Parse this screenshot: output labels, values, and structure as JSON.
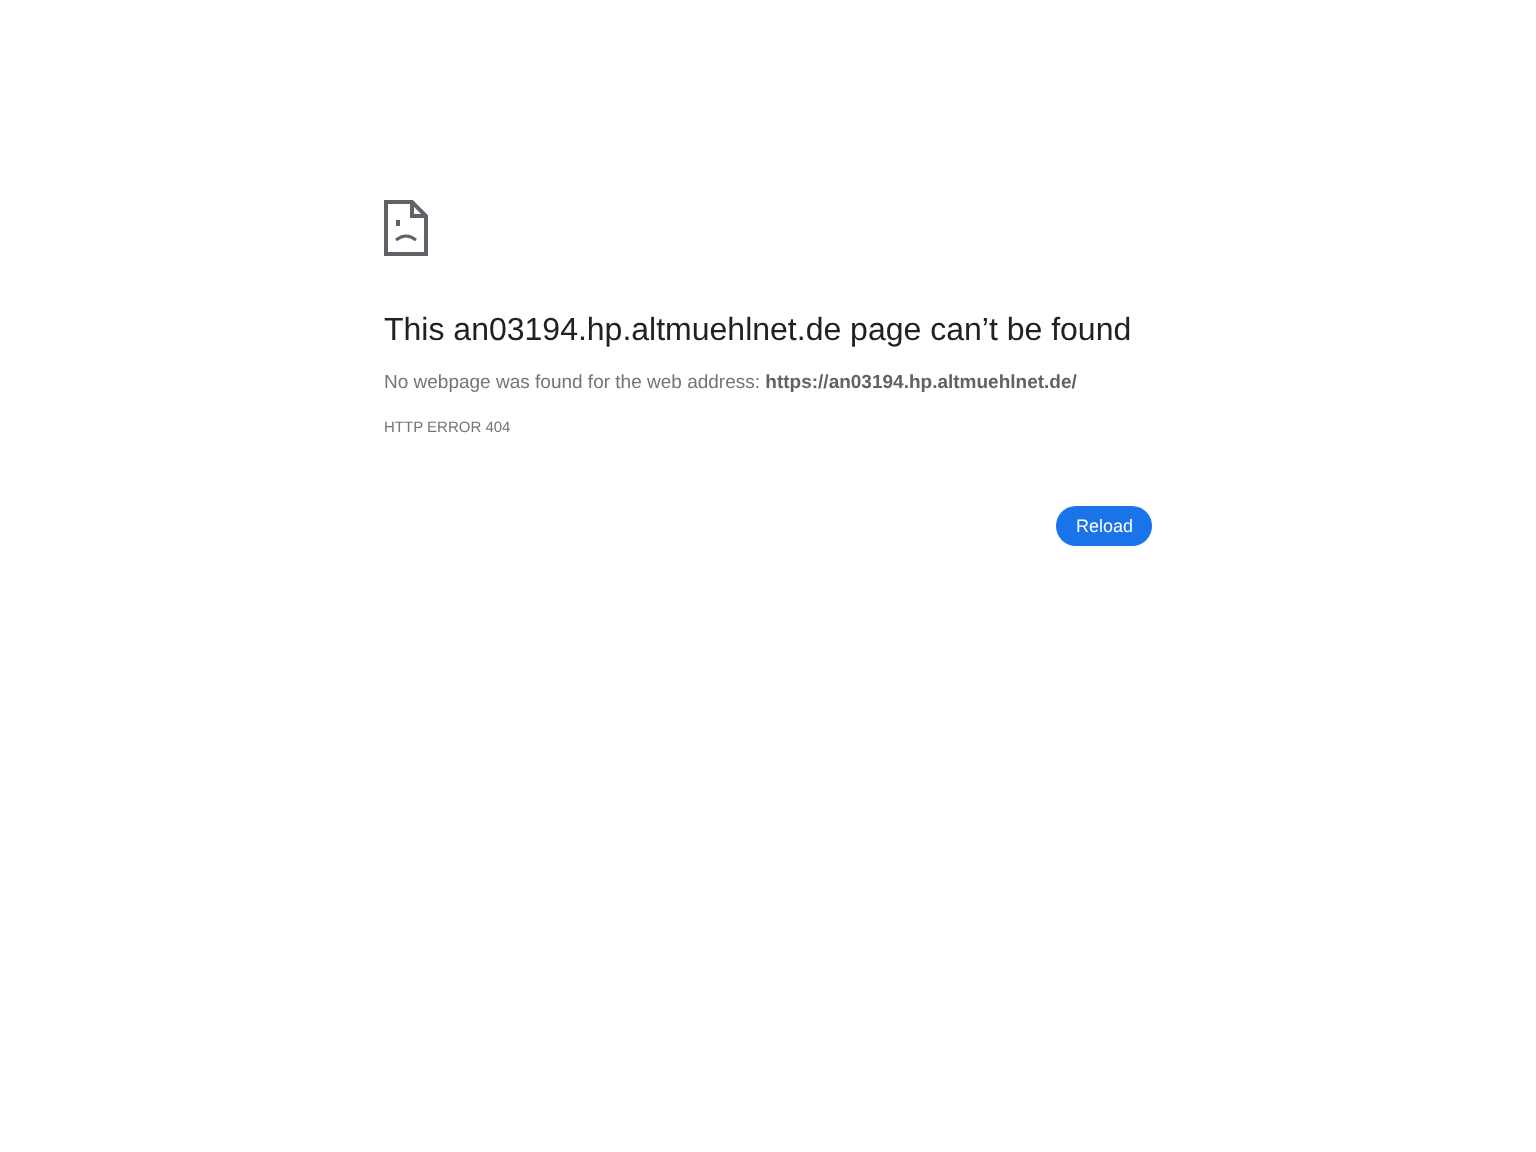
{
  "heading": "This an03194.hp.altmuehlnet.de page can’t be found",
  "message": "No webpage was found for the web address: **https://an03194.hp.altmuehlnet.de/**",
  "error_code": "HTTP ERROR 404",
  "buttons": [
    "Reload"
  ]
}
